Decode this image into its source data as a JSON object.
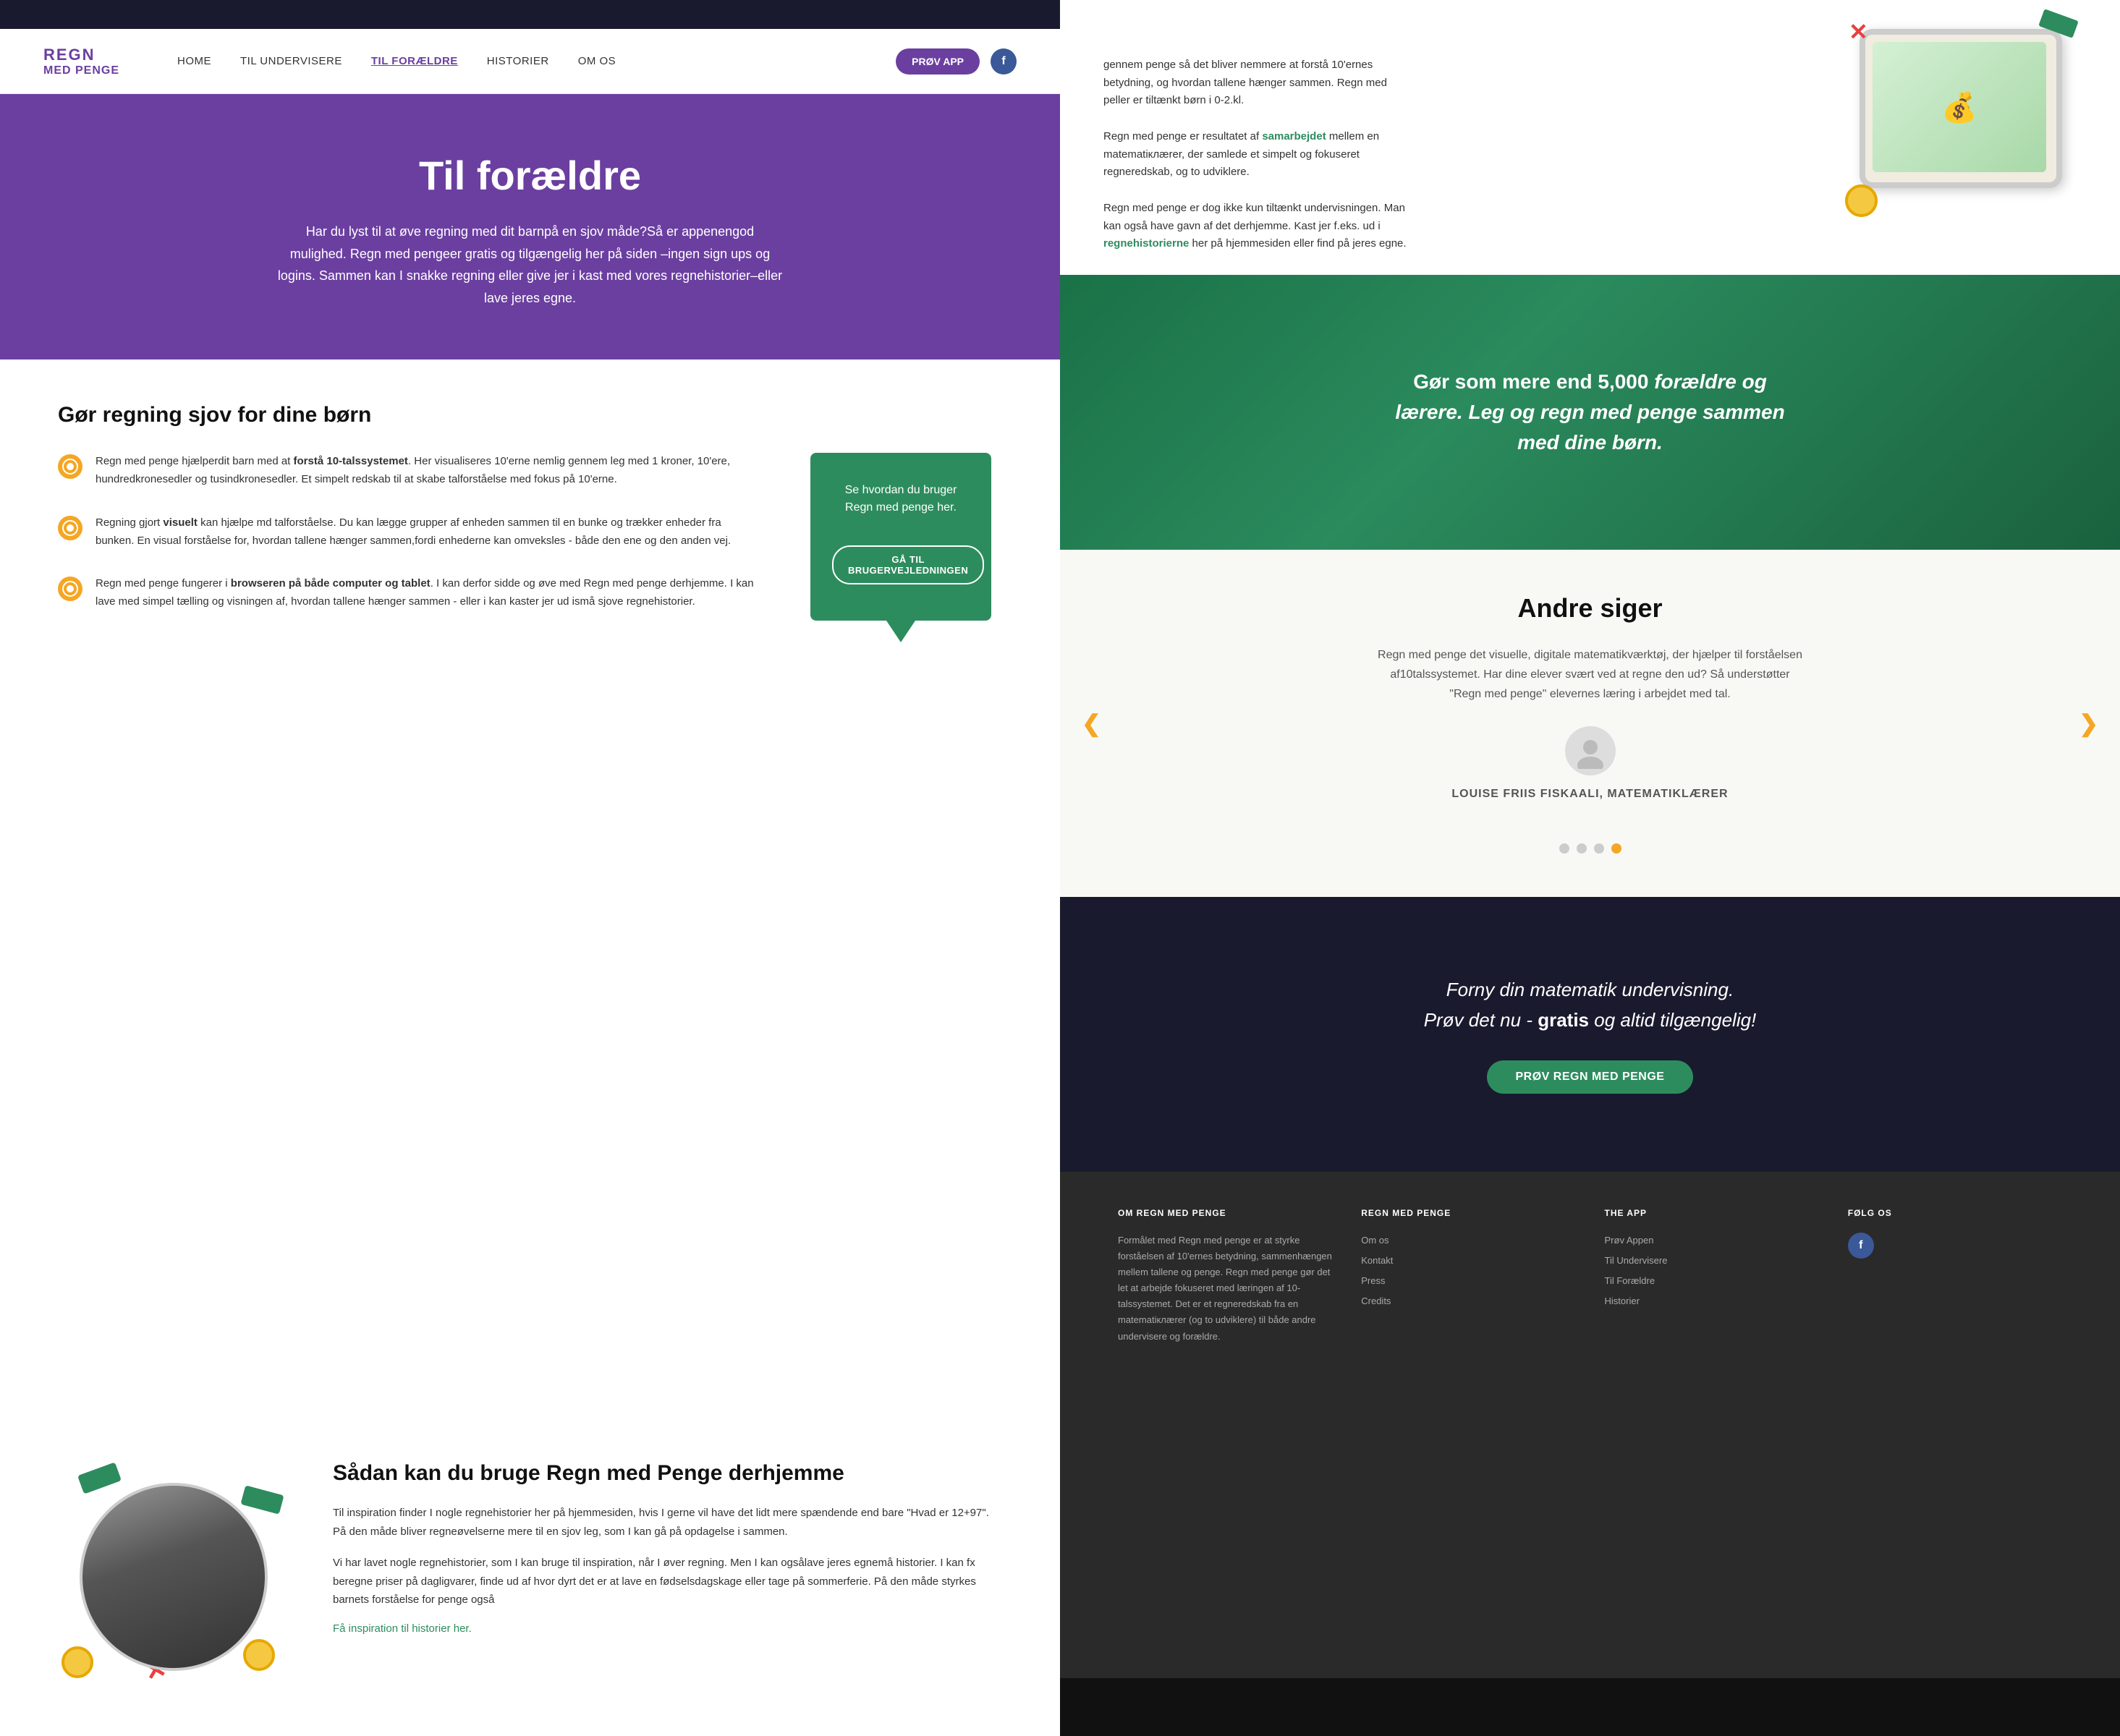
{
  "meta": {
    "title": "Regn med Penge - Til forældre"
  },
  "topbar": {},
  "navbar": {
    "logo_top": "REGN",
    "logo_bottom": "MED PENGE",
    "links": [
      {
        "label": "HOME",
        "active": false
      },
      {
        "label": "TIL UNDERVISERE",
        "active": false
      },
      {
        "label": "TIL FORÆLDRE",
        "active": true
      },
      {
        "label": "HISTORIER",
        "active": false
      },
      {
        "label": "OM OS",
        "active": false
      }
    ],
    "cta_btn": "PRØV APP",
    "fb_label": "f"
  },
  "hero": {
    "title": "Til forældre",
    "body": "Har du lyst til at øve regning med dit barnpå en sjov måde?Så er appenengod mulighed. Regn med pengeer gratis og tilgængelig her på siden –ingen sign ups og logins. Sammen kan I snakke regning eller give jer i kast med vores regnehistorier–eller lave jeres egne."
  },
  "features": {
    "heading": "Gør regning sjov for dine børn",
    "items": [
      {
        "text_html": "Regn med penge hjælperdit barn med at forstå 10-talssystemet. Her visualiseres 10'erne nemlig gennem leg med 1 kroner, 10'ere, hundredkronesedler og tusindkronesedler. Et simpelt redskab til at skabe talforståelse med fokus på 10'erne."
      },
      {
        "text_html": "Regning gjort visuelt kan hjælpe md talforståelse. Du kan lægge grupper af enheden sammen til en bunke og trækker enheder fra bunken. En visual forståelse for, hvordan tallene hænger sammen,fordi enhederne kan omveksles - både den ene og den anden vej."
      },
      {
        "text_html": "Regn med penge fungerer i browseren på både computer og tablet. I kan derfor sidde og øve med Regn med penge derhjemme. I kan lave med simpel tælling og visningen af, hvordan tallene hænger sammen - eller i kan kaster jer ud ismå sjove regnehistorier."
      }
    ],
    "bubble_text": "Se hvordan du bruger Regn med penge her.",
    "bubble_btn": "GÅ TIL BRUGERVEJLEDNINGEN"
  },
  "sadan": {
    "heading": "Sådan kan du bruge Regn med Penge derhjemme",
    "p1": "Til inspiration finder I nogle regnehistorier her på hjemmesiden, hvis I gerne vil have det lidt mere spændende end bare \"Hvad er 12+97\". På den måde bliver regneøvelserne mere til en sjov leg, som I kan gå på opdagelse i sammen.",
    "p2": "Vi har lavet nogle regnehistorier, som I kan bruge til inspiration, når I øver regning. Men I kan ogsålave jeres egnemå historier. I kan fx beregne priser på dagligvarer, finde ud af hvor dyrt det er at lave en fødselsdagskage eller tage på sommerferie. På den måde styrkes barnets forståelse for penge også",
    "link": "Få inspiration til historier her."
  },
  "app_preview": {
    "text_parts": [
      "gennem penge så det bliver nemmere at forstå 10'ernes betydning, og hvordan tallene hænger sammen. Regn med peller er tiltænkt børn i 0-2.kl.",
      "Regn med penge er resultatet af samarbejdet mellem en matematiклærer, der samlede et simpelt og fokuseret regneredskab, og to udviklere.",
      "Regn med penge er dog ikke kun tiltænkt undervisningen. Man kan også have gavn af det derhjemme. Kast jer f.eks. ud i regnehistorierne her på hjemmesiden eller find på jeres egne."
    ]
  },
  "green_banner": {
    "text": "Gør som mere end 5,000 forældre og lærere. Leg og regn med penge sammen med dine børn.",
    "bold": "5,000"
  },
  "andre": {
    "heading": "Andre siger",
    "body": "Regn med penge  det visuelle, digitale matematikværktøj, der hjælper til forståelsen af10talssystemet. Har dine elever svært ved at regne den ud? Så understøtter \"Regn med penge\" elevernes læring i arbejdet med tal.",
    "name": "LOUISE FRIIS FISKAALI, MATEMATIKLÆRER",
    "dots": [
      false,
      false,
      false,
      true
    ],
    "arrow_left": "❮",
    "arrow_right": "❯"
  },
  "dark_cta": {
    "line1": "Forny din matematik undervisning.",
    "line2": "Prøv det nu -",
    "bold": "gratis",
    "line3": "og altid tilgængelig!",
    "btn": "PRØV REGN MED PENGE"
  },
  "footer": {
    "col1": {
      "heading": "OM REGN MED PENGE",
      "text": "Formålet med Regn med penge er at styrke forståelsen af 10'ernes betydning, sammenhængen mellem tallene og penge. Regn med penge gør det let at arbejde fokuseret med læringen af 10-talssystemet. Det er et regneredskab fra en matematiклærer (og to udviklere) til både andre undervisere og forældre."
    },
    "col2": {
      "heading": "REGN MED PENGE",
      "links": [
        "Om os",
        "Kontakt",
        "Press",
        "Credits"
      ]
    },
    "col3": {
      "heading": "THE APP",
      "links": [
        "Prøv Appen",
        "Til Undervisere",
        "Til Forældre",
        "Historier"
      ]
    },
    "col4": {
      "heading": "FØLG OS",
      "fb_label": "f"
    }
  }
}
